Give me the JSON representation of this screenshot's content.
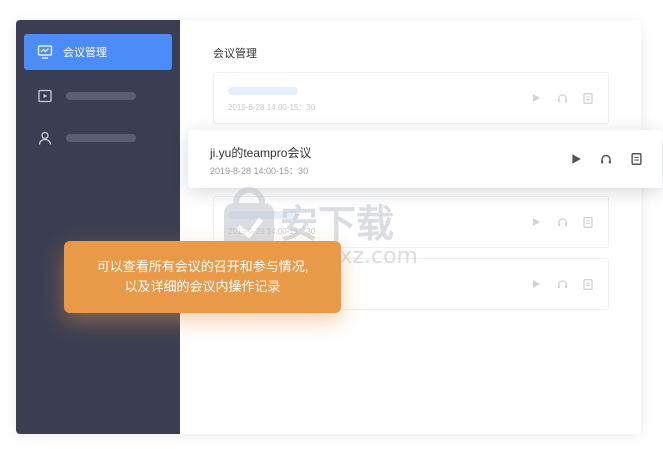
{
  "sidebar": {
    "items": [
      {
        "label": "会议管理",
        "icon": "monitor-chart-icon",
        "active": true
      },
      {
        "label": "",
        "icon": "play-screen-icon",
        "active": false
      },
      {
        "label": "",
        "icon": "user-icon",
        "active": false
      }
    ]
  },
  "main": {
    "title": "会议管理",
    "cards": [
      {
        "meta": "2019-8-28 14:00-15：30"
      },
      {
        "meta": "2019-8-28 14:00-15：30"
      },
      {
        "meta": ""
      }
    ]
  },
  "highlight_card": {
    "title": "ji.yu的teampro会议",
    "meta": "2019-8-28 14:00-15：30",
    "actions": [
      "play-icon",
      "headphones-icon",
      "document-icon"
    ]
  },
  "tooltip": {
    "line1": "可以查看所有会议的召开和参与情况,",
    "line2": "以及详细的会议内操作记录"
  },
  "watermark": {
    "text": "安下载",
    "sub": "anxz.com"
  },
  "colors": {
    "sidebar_bg": "#3b3e52",
    "active_item": "#4b8cf8",
    "tooltip_bg": "#e89a49"
  }
}
